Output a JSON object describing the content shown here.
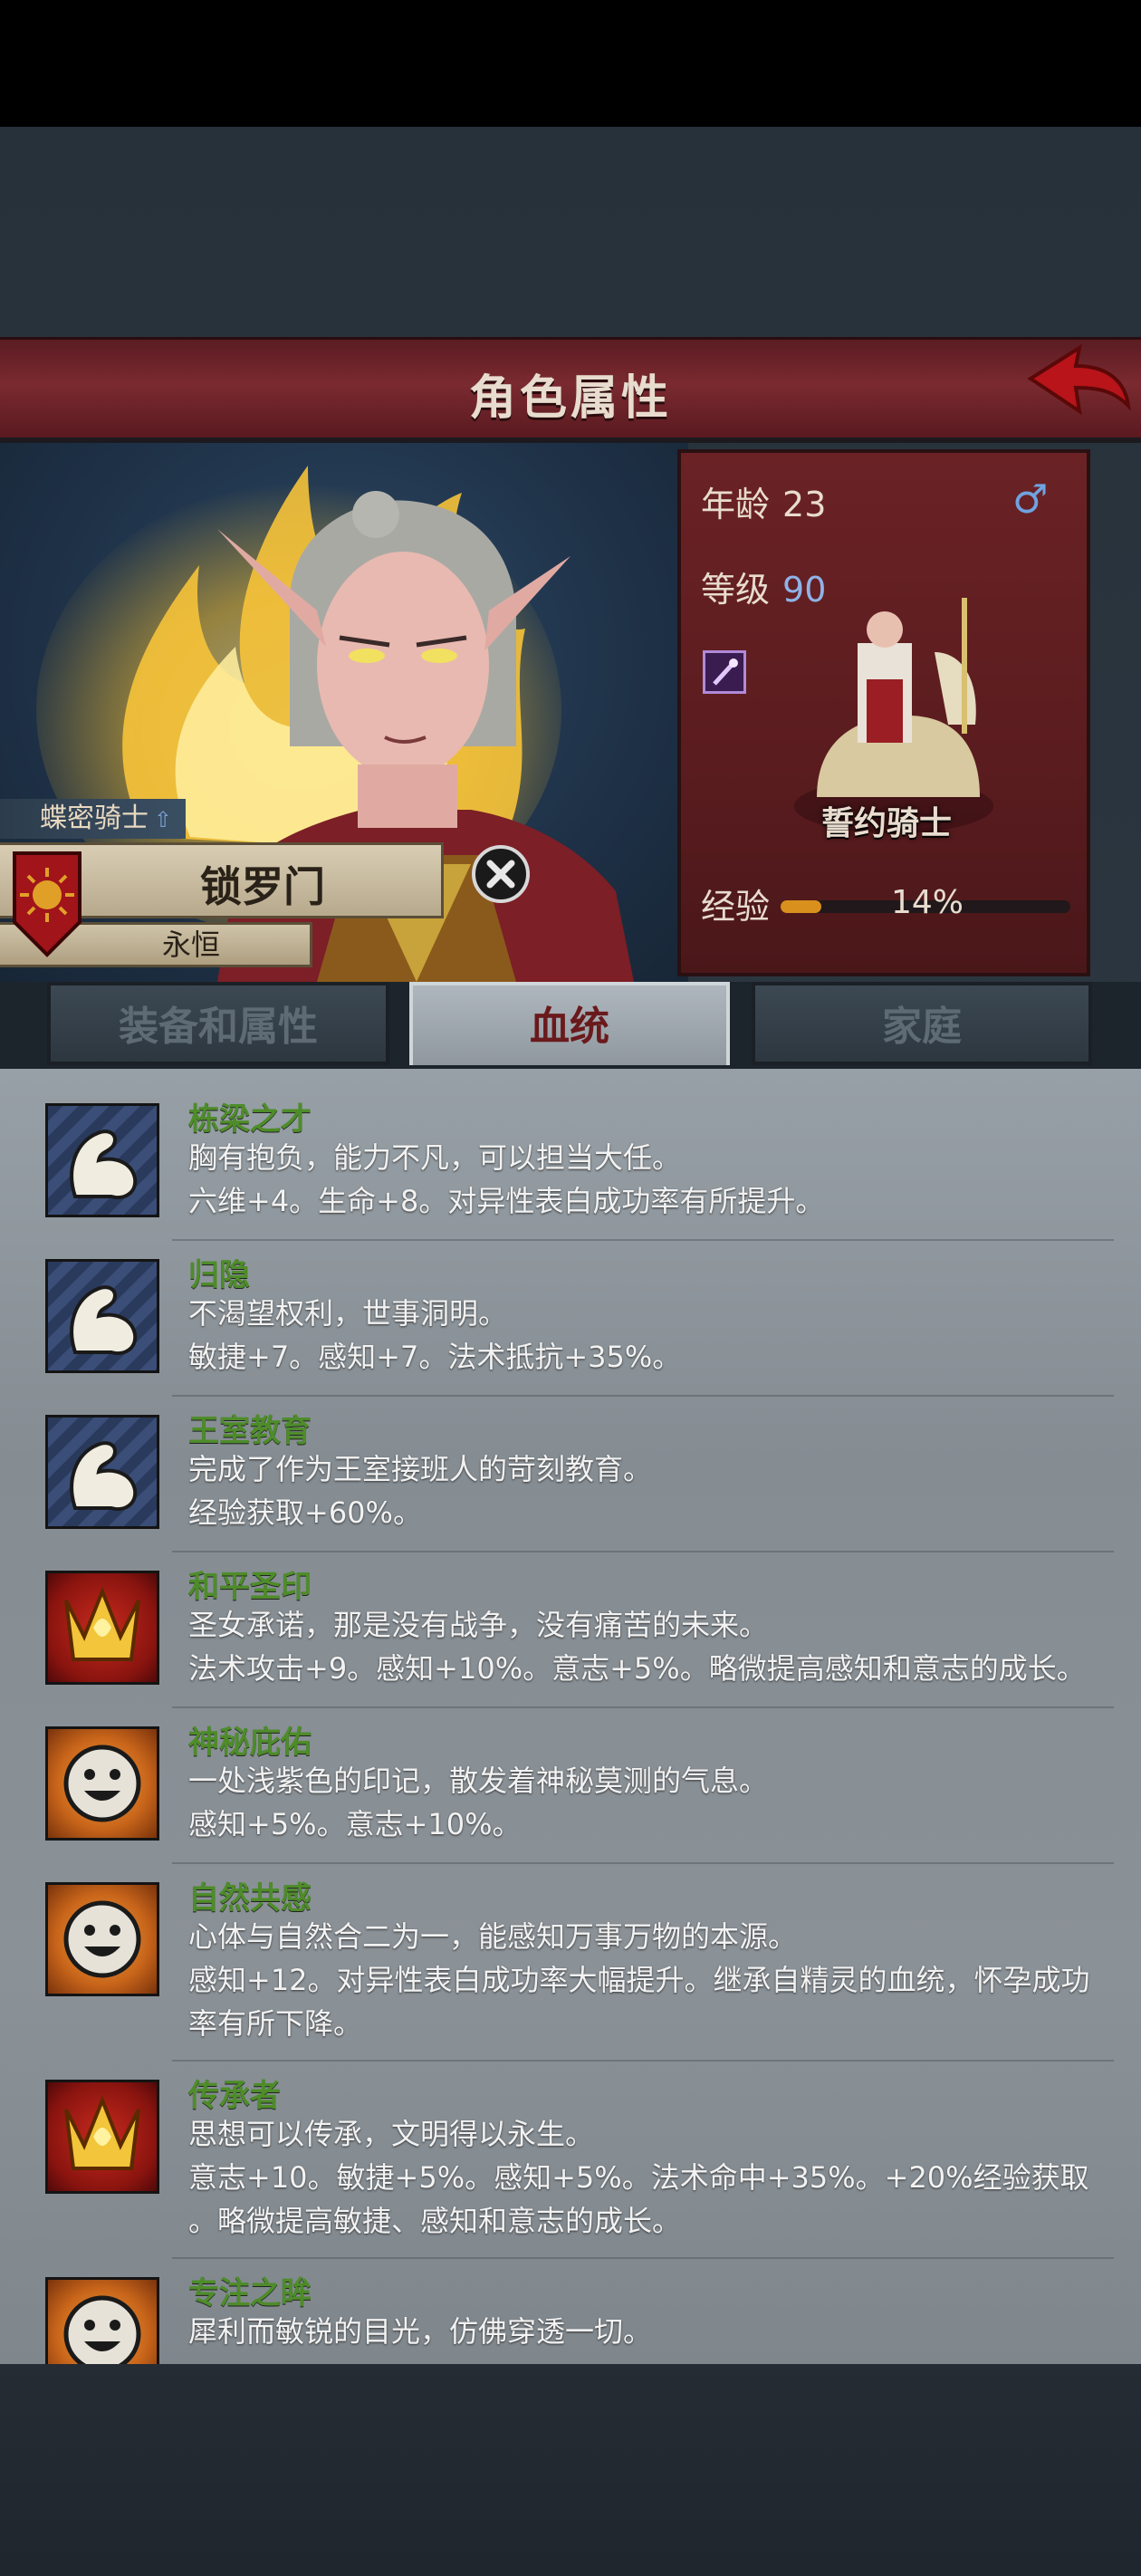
{
  "header": {
    "title": "角色属性"
  },
  "character": {
    "class": "蝶密骑士",
    "name": "锁罗门",
    "title": "永恒"
  },
  "stats": {
    "age_label": "年龄",
    "age": "23",
    "level_label": "等级",
    "level": "90",
    "mount_name": "誓约骑士",
    "exp_label": "经验",
    "exp_percent": "14%",
    "exp_fraction": 0.14,
    "gender_icon": "male-icon"
  },
  "tabs": [
    {
      "label": "装备和属性",
      "active": false
    },
    {
      "label": "血统",
      "active": true
    },
    {
      "label": "家庭",
      "active": false
    }
  ],
  "bloodlines": [
    {
      "icon": "arm-icon",
      "name": "栋梁之才",
      "lines": [
        "胸有抱负，能力不凡，可以担当大任。",
        "六维+4。生命+8。对异性表白成功率有所提升。"
      ]
    },
    {
      "icon": "arm-icon",
      "name": "归隐",
      "lines": [
        "不渴望权利，世事洞明。",
        "敏捷+7。感知+7。法术抵抗+35%。"
      ]
    },
    {
      "icon": "arm-icon",
      "name": "王室教育",
      "lines": [
        "完成了作为王室接班人的苛刻教育。",
        "经验获取+60%。"
      ]
    },
    {
      "icon": "crown-icon",
      "name": "和平圣印",
      "lines": [
        "圣女承诺，那是没有战争，没有痛苦的未来。",
        "法术攻击+9。感知+10%。意志+5%。略微提高感知和意志的成长。"
      ]
    },
    {
      "icon": "sun-icon",
      "name": "神秘庇佑",
      "lines": [
        "一处浅紫色的印记，散发着神秘莫测的气息。",
        "感知+5%。意志+10%。"
      ]
    },
    {
      "icon": "sun-icon",
      "name": "自然共感",
      "lines": [
        "心体与自然合二为一，能感知万事万物的本源。",
        "感知+12。对异性表白成功率大幅提升。继承自精灵的血统，怀孕成功",
        "率有所下降。"
      ]
    },
    {
      "icon": "crown-icon",
      "name": "传承者",
      "lines": [
        "思想可以传承，文明得以永生。",
        "意志+10。敏捷+5%。感知+5%。法术命中+35%。+20%经验获取",
        "。略微提高敏捷、感知和意志的成长。"
      ]
    },
    {
      "icon": "sun-icon",
      "name": "专注之眸",
      "lines": [
        "犀利而敏锐的目光，仿佛穿透一切。"
      ]
    }
  ]
}
